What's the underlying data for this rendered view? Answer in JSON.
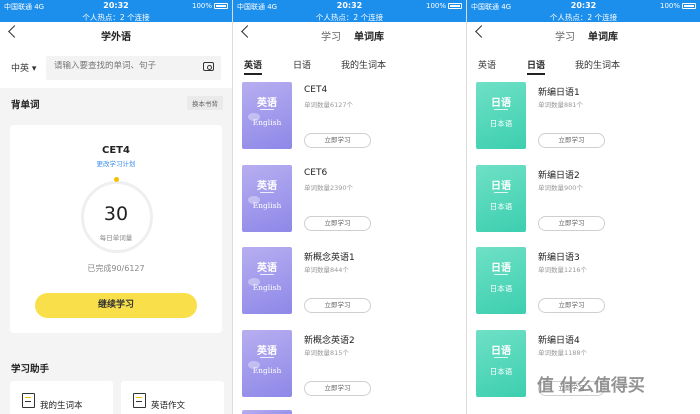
{
  "status": {
    "carrier": "中国联通 4G",
    "time": "20:32",
    "battery": "100%",
    "hotspot_p1": "个人热点：2 个连接",
    "hotspot": "个人热点：2 个连接"
  },
  "panel1": {
    "title": "学外语",
    "lang": "中英 ▾",
    "search_placeholder": "请输入要查找的单词、句子",
    "section_title": "背单词",
    "swap_label": "换本书背",
    "book_name": "CET4",
    "change_plan": "更改学习计划",
    "daily_count": "30",
    "daily_label": "每日单词量",
    "progress": "已完成90/6127",
    "continue_label": "继续学习",
    "helper_title": "学习助手",
    "tools": [
      "我的生词本",
      "英语作文"
    ]
  },
  "panel2": {
    "nav_tabs": [
      "学习",
      "单词库"
    ],
    "tabs": [
      "英语",
      "日语",
      "我的生词本"
    ],
    "books": [
      {
        "title": "CET4",
        "count": "单词数量6127个",
        "btn": "立即学习",
        "cover_top": "英语",
        "cover_bottom": "English"
      },
      {
        "title": "CET6",
        "count": "单词数量2390个",
        "btn": "立即学习",
        "cover_top": "英语",
        "cover_bottom": "English"
      },
      {
        "title": "新概念英语1",
        "count": "单词数量844个",
        "btn": "立即学习",
        "cover_top": "英语",
        "cover_bottom": "English"
      },
      {
        "title": "新概念英语2",
        "count": "单词数量815个",
        "btn": "立即学习",
        "cover_top": "英语",
        "cover_bottom": "English"
      }
    ]
  },
  "panel3": {
    "nav_tabs": [
      "学习",
      "单词库"
    ],
    "tabs": [
      "英语",
      "日语",
      "我的生词本"
    ],
    "books": [
      {
        "title": "新编日语1",
        "count": "单词数量881个",
        "btn": "立即学习",
        "cover_top": "日语",
        "cover_bottom": "日本语"
      },
      {
        "title": "新编日语2",
        "count": "单词数量900个",
        "btn": "立即学习",
        "cover_top": "日语",
        "cover_bottom": "日本语"
      },
      {
        "title": "新编日语3",
        "count": "单词数量1216个",
        "btn": "立即学习",
        "cover_top": "日语",
        "cover_bottom": "日本语"
      },
      {
        "title": "新编日语4",
        "count": "单词数量1188个",
        "btn": "立即学习",
        "cover_top": "日语",
        "cover_bottom": "日本语"
      }
    ]
  },
  "watermark": "值 什么值得买",
  "colors": {
    "status_bar": "#1c8fed",
    "accent_yellow": "#f9e04b",
    "english_cover": "#9a92ec",
    "japanese_cover": "#4fd6b8",
    "link_blue": "#3b8ee8"
  }
}
